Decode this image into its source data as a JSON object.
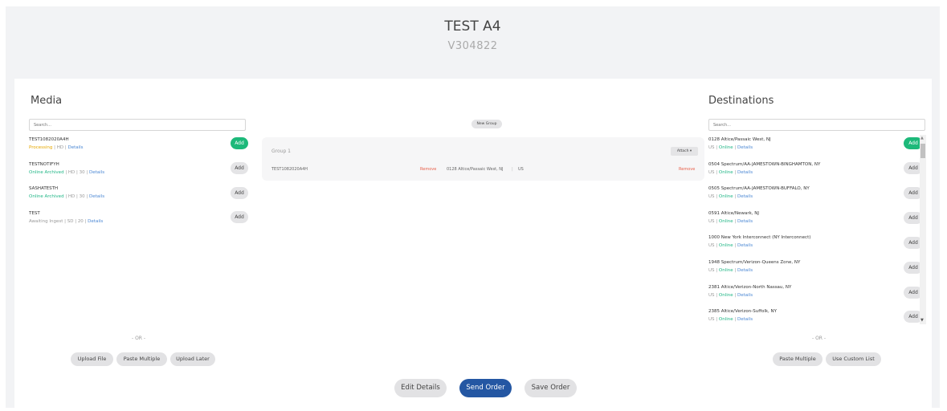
{
  "header": {
    "title": "TEST A4",
    "subtitle": "V304822"
  },
  "media": {
    "title": "Media",
    "search_placeholder": "Search...",
    "items": [
      {
        "name": "TEST1082020A4H",
        "status": "Processing",
        "format": "HD",
        "details": "Details",
        "add": "Add"
      },
      {
        "name": "TESTNOTIFYH",
        "status": "Online Archived",
        "format": "HD",
        "duration": "30",
        "details": "Details",
        "add": "Add"
      },
      {
        "name": "SASHATESTH",
        "status": "Online Archived",
        "format": "HD",
        "duration": "30",
        "details": "Details",
        "add": "Add"
      },
      {
        "name": "TEST",
        "status": "Awaiting Ingest",
        "format": "SD",
        "duration": "20",
        "details": "Details",
        "add": "Add"
      }
    ],
    "or": "- OR -",
    "buttons": {
      "upload_file": "Upload File",
      "paste_multiple": "Paste Multiple",
      "upload_later": "Upload Later"
    }
  },
  "groups": {
    "new_group": "New Group",
    "group": {
      "title": "Group 1",
      "attach": "Attach ▾",
      "media_name": "TEST1082020A4H",
      "remove_media": "Remove",
      "destination": "0128 Altice/Passaic West, NJ",
      "sep": "|",
      "country": "US",
      "remove_destination": "Remove"
    }
  },
  "destinations": {
    "title": "Destinations",
    "search_placeholder": "Search...",
    "items": [
      {
        "name": "0128 Altice/Passaic West, NJ",
        "country": "US",
        "status": "Online",
        "details": "Details",
        "add": "Add"
      },
      {
        "name": "0504 Spectrum/AA-JAMESTOWN-BINGHAMTON, NY",
        "country": "US",
        "status": "Online",
        "details": "Details",
        "add": "Add"
      },
      {
        "name": "0505 Spectrum/AA-JAMESTOWN-BUFFALO, NY",
        "country": "US",
        "status": "Online",
        "details": "Details",
        "add": "Add"
      },
      {
        "name": "0591 Altice/Newark, NJ",
        "country": "US",
        "status": "Online",
        "details": "Details",
        "add": "Add"
      },
      {
        "name": "1000 New York Interconnect (NY Interconnect)",
        "country": "US",
        "status": "Online",
        "details": "Details",
        "add": "Add"
      },
      {
        "name": "1948 Spectrum/Verizon-Queens Zone, NY",
        "country": "US",
        "status": "Online",
        "details": "Details",
        "add": "Add"
      },
      {
        "name": "2381 Altice/Verizon-North Nassau, NY",
        "country": "US",
        "status": "Online",
        "details": "Details",
        "add": "Add"
      },
      {
        "name": "2385 Altice/Verizon-Suffolk, NY",
        "country": "US",
        "status": "Online",
        "details": "Details",
        "add": "Add"
      }
    ],
    "or": "- OR -",
    "buttons": {
      "paste_multiple": "Paste Multiple",
      "use_custom_list": "Use Custom List"
    }
  },
  "actions": {
    "edit_details": "Edit Details",
    "send_order": "Send Order",
    "save_order": "Save Order"
  },
  "colors": {
    "add_active": "#1db97a",
    "primary": "#2457a3",
    "online": "#1fb585",
    "processing": "#e6a800",
    "link": "#4a87d4",
    "remove": "#e8604a"
  }
}
